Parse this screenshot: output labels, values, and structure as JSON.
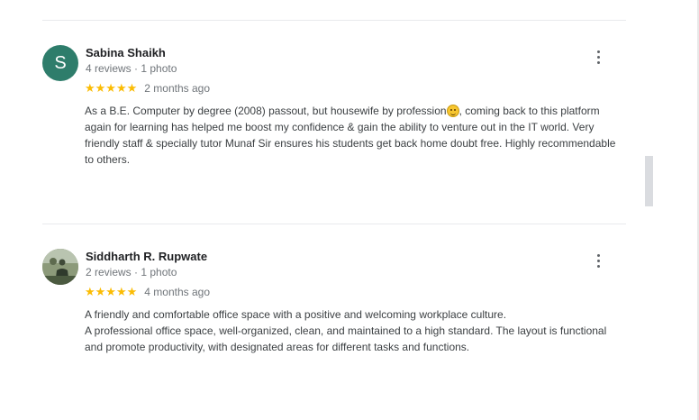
{
  "reviews": [
    {
      "avatar_letter": "S",
      "name": "Sabina Shaikh",
      "meta": "4 reviews · 1 photo",
      "stars": "★★★★★",
      "rating": 5,
      "when": "2 months ago",
      "text_before_emoji": "As a B.E. Computer by degree (2008) passout, but housewife by profession",
      "emoji": "smiling-face-emoji",
      "text_after_emoji": ", coming back to this platform again for learning has helped me boost my confidence & gain the ability to venture out in the IT world. Very friendly staff & specially tutor Munaf Sir ensures his students get back home doubt free. Highly recommendable to others."
    },
    {
      "name": "Siddharth R. Rupwate",
      "meta": "2 reviews · 1 photo",
      "stars": "★★★★★",
      "rating": 5,
      "when": "4 months ago",
      "text_line_1": "A friendly and comfortable office space with a positive and welcoming workplace culture.",
      "text_line_2": "A professional office space, well-organized, clean, and maintained to a high standard. The layout is functional and promote productivity, with designated areas for different tasks and functions."
    }
  ],
  "colors": {
    "star": "#fbbc04",
    "avatar_bg": "#2e7d6b",
    "meta": "#70757a"
  }
}
